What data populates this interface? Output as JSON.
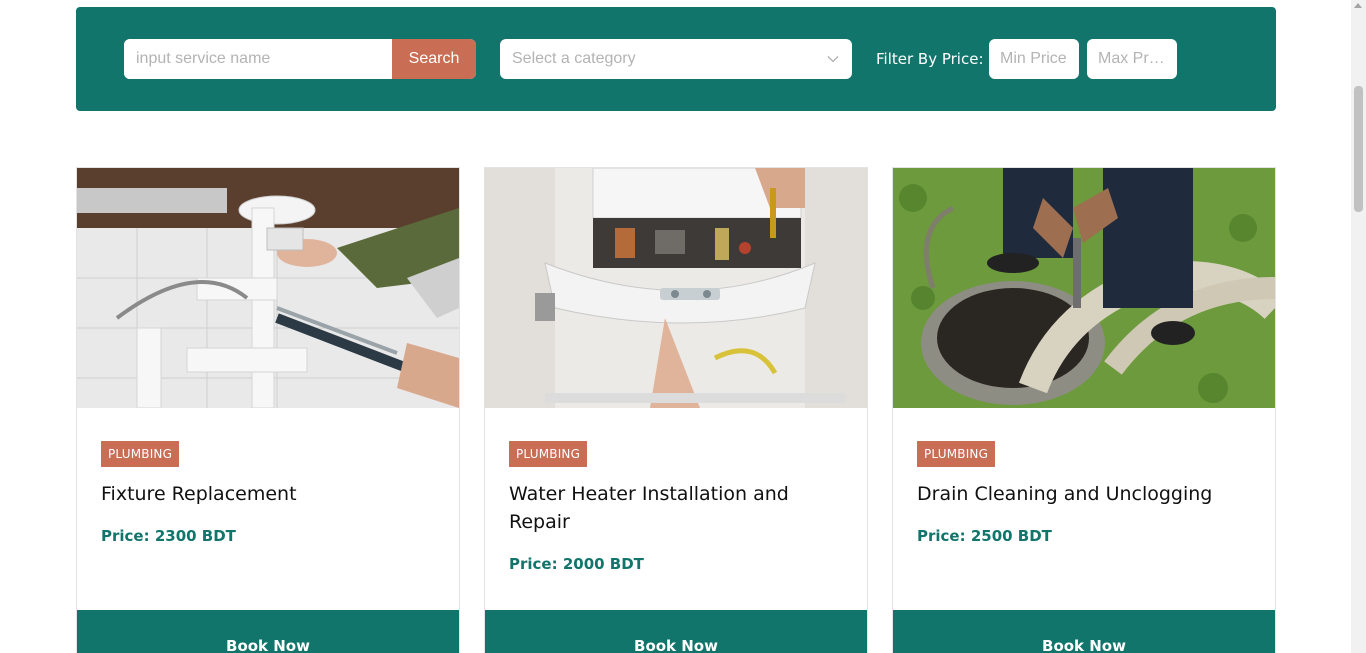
{
  "filter_bar": {
    "search_placeholder": "input service name",
    "search_button": "Search",
    "category_placeholder": "Select a category",
    "price_label": "Filter By Price:",
    "min_price_placeholder": "Min Price",
    "max_price_placeholder": "Max Price"
  },
  "colors": {
    "primary": "#11756c",
    "accent": "#c96d55"
  },
  "services": [
    {
      "category": "PLUMBING",
      "title": "Fixture Replacement",
      "price": "Price: 2300 BDT",
      "button": "Book Now",
      "image_icon": "plumber-fixing-sink-image"
    },
    {
      "category": "PLUMBING",
      "title": "Water Heater Installation and Repair",
      "price": "Price: 2000 BDT",
      "button": "Book Now",
      "image_icon": "water-heater-repair-image"
    },
    {
      "category": "PLUMBING",
      "title": "Drain Cleaning and Unclogging",
      "price": "Price: 2500 BDT",
      "button": "Book Now",
      "image_icon": "drain-cleaning-image"
    }
  ]
}
